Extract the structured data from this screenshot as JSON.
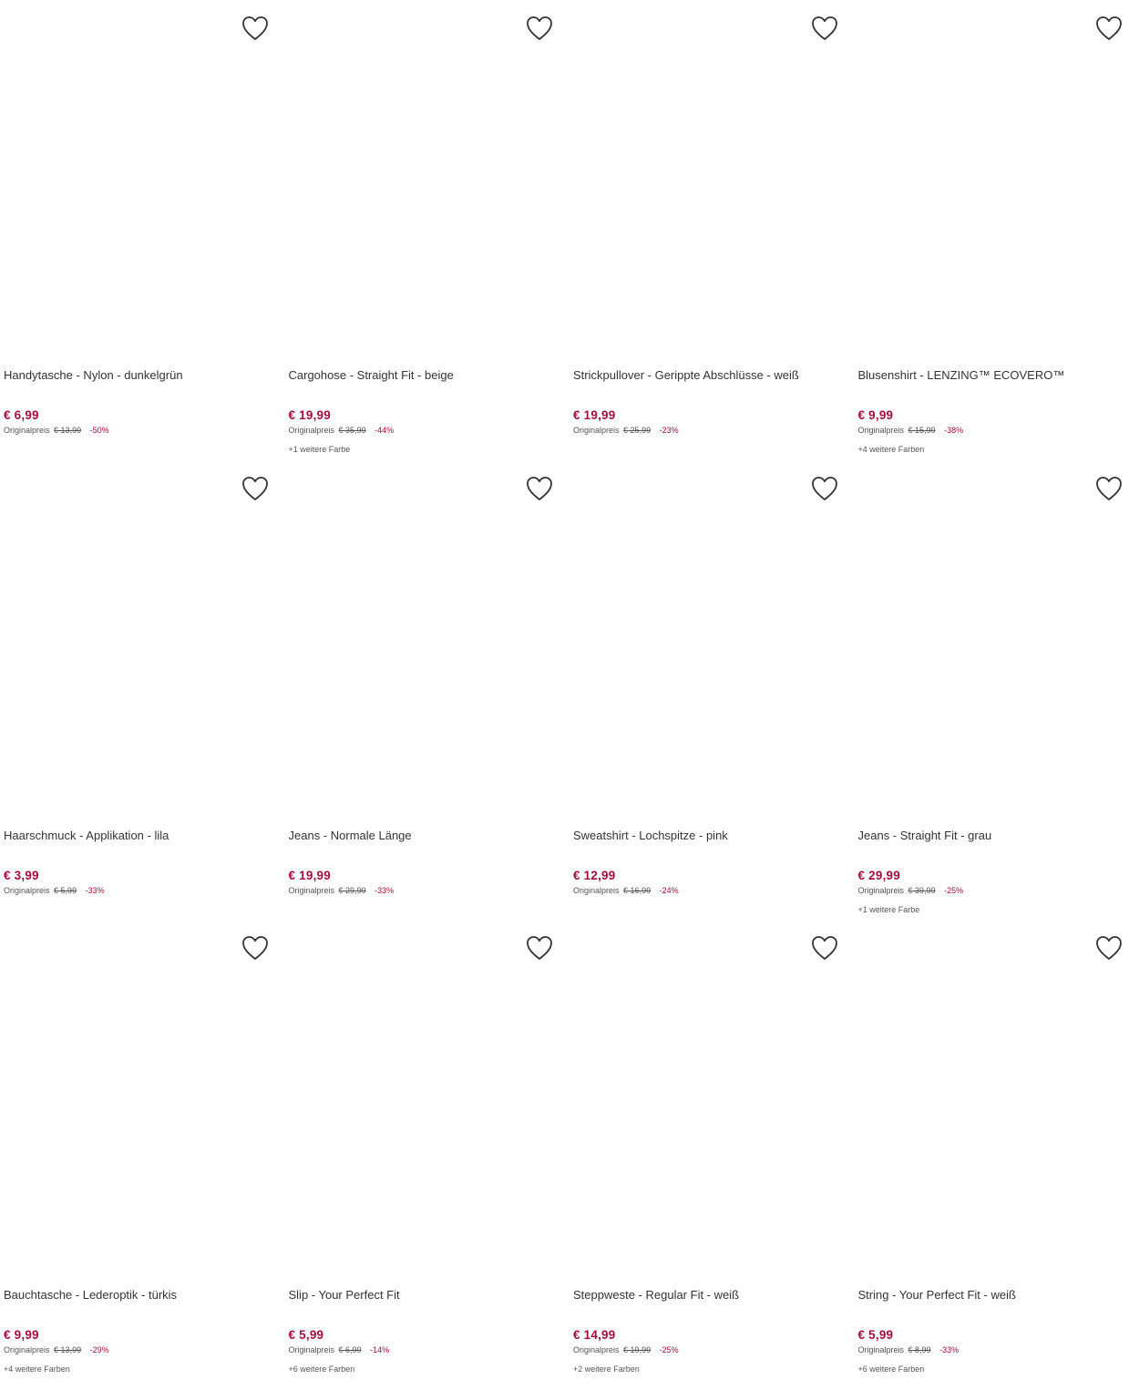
{
  "products": [
    {
      "title": "Handytasche - Nylon - dunkelgrün",
      "price": "€ 6,99",
      "original_label": "Originalpreis",
      "original_price": "€ 13,99",
      "discount": "-50%",
      "colors": ""
    },
    {
      "title": "Cargohose - Straight Fit - beige",
      "price": "€ 19,99",
      "original_label": "Originalpreis",
      "original_price": "€ 35,99",
      "discount": "-44%",
      "colors": "+1 weitere Farbe"
    },
    {
      "title": "Strickpullover - Gerippte Abschlüsse - weiß",
      "price": "€ 19,99",
      "original_label": "Originalpreis",
      "original_price": "€ 25,99",
      "discount": "-23%",
      "colors": ""
    },
    {
      "title": "Blusenshirt - LENZING™ ECOVERO™",
      "price": "€ 9,99",
      "original_label": "Originalpreis",
      "original_price": "€ 15,99",
      "discount": "-38%",
      "colors": "+4 weitere Farben"
    },
    {
      "title": "Haarschmuck - Applikation - lila",
      "price": "€ 3,99",
      "original_label": "Originalpreis",
      "original_price": "€ 5,99",
      "discount": "-33%",
      "colors": ""
    },
    {
      "title": "Jeans - Normale Länge",
      "price": "€ 19,99",
      "original_label": "Originalpreis",
      "original_price": "€ 29,99",
      "discount": "-33%",
      "colors": ""
    },
    {
      "title": "Sweatshirt - Lochspitze - pink",
      "price": "€ 12,99",
      "original_label": "Originalpreis",
      "original_price": "€ 16,99",
      "discount": "-24%",
      "colors": ""
    },
    {
      "title": "Jeans - Straight Fit - grau",
      "price": "€ 29,99",
      "original_label": "Originalpreis",
      "original_price": "€ 39,99",
      "discount": "-25%",
      "colors": "+1 weitere Farbe"
    },
    {
      "title": "Bauchtasche - Lederoptik - türkis",
      "price": "€ 9,99",
      "original_label": "Originalpreis",
      "original_price": "€ 13,99",
      "discount": "-29%",
      "colors": "+4 weitere Farben"
    },
    {
      "title": "Slip - Your Perfect Fit",
      "price": "€ 5,99",
      "original_label": "Originalpreis",
      "original_price": "€ 6,99",
      "discount": "-14%",
      "colors": "+6 weitere Farben"
    },
    {
      "title": "Steppweste - Regular Fit - weiß",
      "price": "€ 14,99",
      "original_label": "Originalpreis",
      "original_price": "€ 19,99",
      "discount": "-25%",
      "colors": "+2 weitere Farben"
    },
    {
      "title": "String - Your Perfect Fit - weiß",
      "price": "€ 5,99",
      "original_label": "Originalpreis",
      "original_price": "€ 8,99",
      "discount": "-33%",
      "colors": "+6 weitere Farben"
    }
  ],
  "colors": {
    "sale": "#a50e3b",
    "text": "#333333",
    "muted": "#555555"
  },
  "icons": {
    "wishlist": "heart-outline-icon"
  }
}
